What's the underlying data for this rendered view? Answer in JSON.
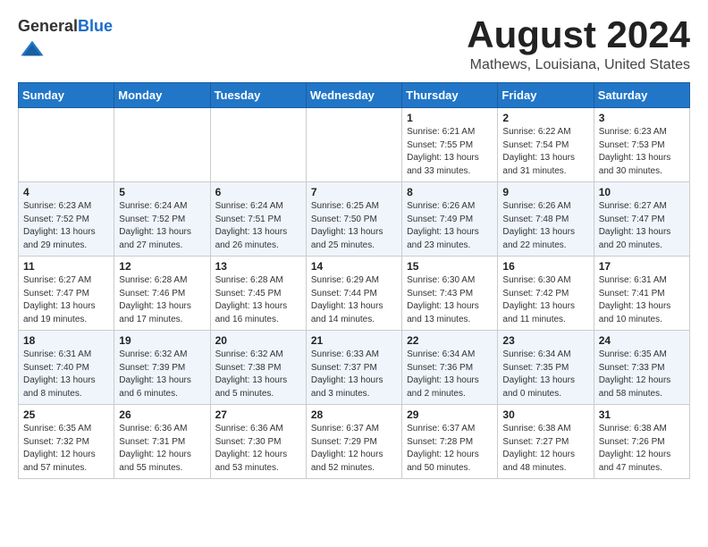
{
  "logo": {
    "general": "General",
    "blue": "Blue"
  },
  "title": "August 2024",
  "subtitle": "Mathews, Louisiana, United States",
  "days_of_week": [
    "Sunday",
    "Monday",
    "Tuesday",
    "Wednesday",
    "Thursday",
    "Friday",
    "Saturday"
  ],
  "weeks": [
    [
      {
        "day": "",
        "info": ""
      },
      {
        "day": "",
        "info": ""
      },
      {
        "day": "",
        "info": ""
      },
      {
        "day": "",
        "info": ""
      },
      {
        "day": "1",
        "info": "Sunrise: 6:21 AM\nSunset: 7:55 PM\nDaylight: 13 hours\nand 33 minutes."
      },
      {
        "day": "2",
        "info": "Sunrise: 6:22 AM\nSunset: 7:54 PM\nDaylight: 13 hours\nand 31 minutes."
      },
      {
        "day": "3",
        "info": "Sunrise: 6:23 AM\nSunset: 7:53 PM\nDaylight: 13 hours\nand 30 minutes."
      }
    ],
    [
      {
        "day": "4",
        "info": "Sunrise: 6:23 AM\nSunset: 7:52 PM\nDaylight: 13 hours\nand 29 minutes."
      },
      {
        "day": "5",
        "info": "Sunrise: 6:24 AM\nSunset: 7:52 PM\nDaylight: 13 hours\nand 27 minutes."
      },
      {
        "day": "6",
        "info": "Sunrise: 6:24 AM\nSunset: 7:51 PM\nDaylight: 13 hours\nand 26 minutes."
      },
      {
        "day": "7",
        "info": "Sunrise: 6:25 AM\nSunset: 7:50 PM\nDaylight: 13 hours\nand 25 minutes."
      },
      {
        "day": "8",
        "info": "Sunrise: 6:26 AM\nSunset: 7:49 PM\nDaylight: 13 hours\nand 23 minutes."
      },
      {
        "day": "9",
        "info": "Sunrise: 6:26 AM\nSunset: 7:48 PM\nDaylight: 13 hours\nand 22 minutes."
      },
      {
        "day": "10",
        "info": "Sunrise: 6:27 AM\nSunset: 7:47 PM\nDaylight: 13 hours\nand 20 minutes."
      }
    ],
    [
      {
        "day": "11",
        "info": "Sunrise: 6:27 AM\nSunset: 7:47 PM\nDaylight: 13 hours\nand 19 minutes."
      },
      {
        "day": "12",
        "info": "Sunrise: 6:28 AM\nSunset: 7:46 PM\nDaylight: 13 hours\nand 17 minutes."
      },
      {
        "day": "13",
        "info": "Sunrise: 6:28 AM\nSunset: 7:45 PM\nDaylight: 13 hours\nand 16 minutes."
      },
      {
        "day": "14",
        "info": "Sunrise: 6:29 AM\nSunset: 7:44 PM\nDaylight: 13 hours\nand 14 minutes."
      },
      {
        "day": "15",
        "info": "Sunrise: 6:30 AM\nSunset: 7:43 PM\nDaylight: 13 hours\nand 13 minutes."
      },
      {
        "day": "16",
        "info": "Sunrise: 6:30 AM\nSunset: 7:42 PM\nDaylight: 13 hours\nand 11 minutes."
      },
      {
        "day": "17",
        "info": "Sunrise: 6:31 AM\nSunset: 7:41 PM\nDaylight: 13 hours\nand 10 minutes."
      }
    ],
    [
      {
        "day": "18",
        "info": "Sunrise: 6:31 AM\nSunset: 7:40 PM\nDaylight: 13 hours\nand 8 minutes."
      },
      {
        "day": "19",
        "info": "Sunrise: 6:32 AM\nSunset: 7:39 PM\nDaylight: 13 hours\nand 6 minutes."
      },
      {
        "day": "20",
        "info": "Sunrise: 6:32 AM\nSunset: 7:38 PM\nDaylight: 13 hours\nand 5 minutes."
      },
      {
        "day": "21",
        "info": "Sunrise: 6:33 AM\nSunset: 7:37 PM\nDaylight: 13 hours\nand 3 minutes."
      },
      {
        "day": "22",
        "info": "Sunrise: 6:34 AM\nSunset: 7:36 PM\nDaylight: 13 hours\nand 2 minutes."
      },
      {
        "day": "23",
        "info": "Sunrise: 6:34 AM\nSunset: 7:35 PM\nDaylight: 13 hours\nand 0 minutes."
      },
      {
        "day": "24",
        "info": "Sunrise: 6:35 AM\nSunset: 7:33 PM\nDaylight: 12 hours\nand 58 minutes."
      }
    ],
    [
      {
        "day": "25",
        "info": "Sunrise: 6:35 AM\nSunset: 7:32 PM\nDaylight: 12 hours\nand 57 minutes."
      },
      {
        "day": "26",
        "info": "Sunrise: 6:36 AM\nSunset: 7:31 PM\nDaylight: 12 hours\nand 55 minutes."
      },
      {
        "day": "27",
        "info": "Sunrise: 6:36 AM\nSunset: 7:30 PM\nDaylight: 12 hours\nand 53 minutes."
      },
      {
        "day": "28",
        "info": "Sunrise: 6:37 AM\nSunset: 7:29 PM\nDaylight: 12 hours\nand 52 minutes."
      },
      {
        "day": "29",
        "info": "Sunrise: 6:37 AM\nSunset: 7:28 PM\nDaylight: 12 hours\nand 50 minutes."
      },
      {
        "day": "30",
        "info": "Sunrise: 6:38 AM\nSunset: 7:27 PM\nDaylight: 12 hours\nand 48 minutes."
      },
      {
        "day": "31",
        "info": "Sunrise: 6:38 AM\nSunset: 7:26 PM\nDaylight: 12 hours\nand 47 minutes."
      }
    ]
  ]
}
